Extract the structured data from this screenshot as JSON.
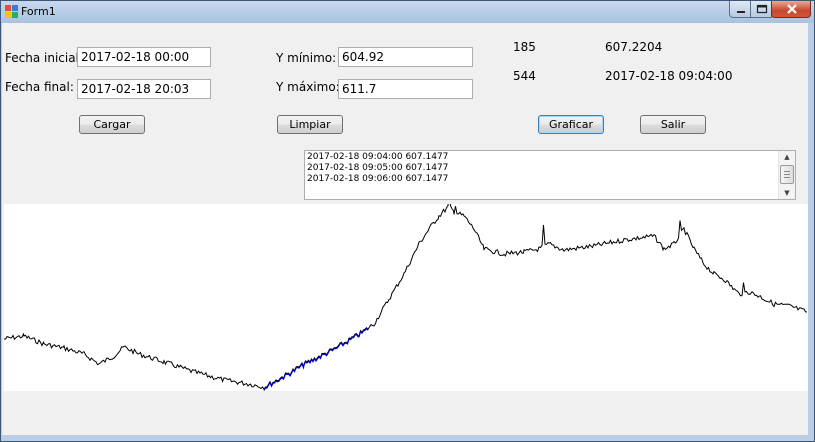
{
  "window": {
    "title": "Form1"
  },
  "form": {
    "fecha_inicial_label": "Fecha inicial:",
    "fecha_inicial_value": "2017-02-18 00:00",
    "fecha_final_label": "Fecha final:",
    "fecha_final_value": "2017-02-18 20:03",
    "ymin_label": "Y mínimo:",
    "ymin_value": "604.92",
    "ymax_label": "Y máximo:",
    "ymax_value": "611.7"
  },
  "info": {
    "row1_index": "185",
    "row1_value": "607.2204",
    "row2_index": "544",
    "row2_value": "2017-02-18 09:04:00"
  },
  "buttons": {
    "cargar": "Cargar",
    "limpiar": "Limpiar",
    "graficar": "Graficar",
    "salir": "Salir"
  },
  "listbox": {
    "lines": [
      "2017-02-18 09:04:00 607.1477",
      "2017-02-18 09:05:00 607.1477",
      "2017-02-18 09:06:00 607.1477"
    ]
  },
  "plot": {
    "series_color": "#000000",
    "highlight_color": "#0000cc"
  }
}
